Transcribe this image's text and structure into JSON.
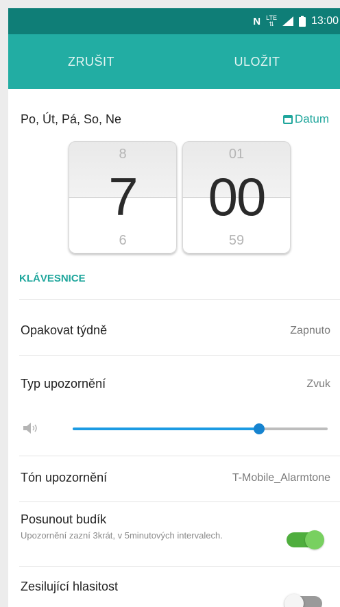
{
  "status_bar": {
    "icons": [
      "nfc-icon",
      "lte-icon",
      "signal-icon",
      "battery-icon"
    ],
    "lte_label": "LTE",
    "time": "13:00"
  },
  "action_bar": {
    "cancel_label": "ZRUŠIT",
    "save_label": "ULOŽIT"
  },
  "repeat_days": "Po, Út, Pá, So, Ne",
  "date_button_label": "Datum",
  "time_picker": {
    "hour": {
      "prev": "8",
      "current": "7",
      "next": "6"
    },
    "minute": {
      "prev": "01",
      "current": "00",
      "next": "59"
    }
  },
  "keyboard_label": "KLÁVESNICE",
  "settings": {
    "repeat_weekly": {
      "label": "Opakovat týdně",
      "value": "Zapnuto"
    },
    "alert_type": {
      "label": "Typ upozornění",
      "value": "Zvuk"
    },
    "volume": {
      "level": 0.73
    },
    "alert_tone": {
      "label": "Tón upozornění",
      "value": "T-Mobile_Alarmtone"
    },
    "snooze": {
      "label": "Posunout budík",
      "description": "Upozornění zazní 3krát, v 5minutových intervalech.",
      "enabled": true
    },
    "increasing_volume": {
      "label": "Zesilující hlasitost",
      "enabled": false
    }
  },
  "colors": {
    "status_bar": "#0f7e77",
    "action_bar": "#22ada3",
    "accent": "#1fa69c",
    "slider": "#1c9be3",
    "toggle_on": "#4fae3e"
  }
}
